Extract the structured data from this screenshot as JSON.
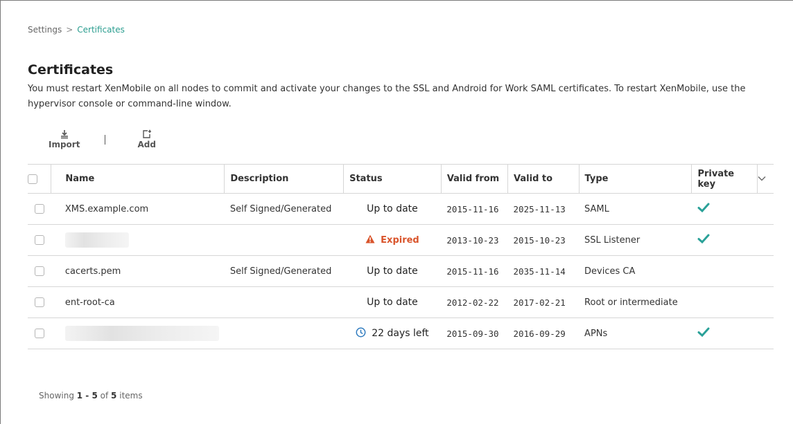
{
  "breadcrumb": {
    "root": "Settings",
    "separator": ">",
    "current": "Certificates"
  },
  "page": {
    "title": "Certificates",
    "intro": "You must restart XenMobile on all nodes to commit and activate your changes to the SSL and Android for Work SAML certificates. To restart XenMobile, use the hypervisor console or command-line window."
  },
  "toolbar": {
    "import_label": "Import",
    "add_label": "Add"
  },
  "table": {
    "headers": {
      "name": "Name",
      "description": "Description",
      "status": "Status",
      "valid_from": "Valid from",
      "valid_to": "Valid to",
      "type": "Type",
      "private_key": "Private key"
    },
    "rows": [
      {
        "name": "XMS.example.com",
        "description": "Self Signed/Generated",
        "status": "Up to date",
        "status_kind": "ok",
        "valid_from": "2015-11-16",
        "valid_to": "2025-11-13",
        "type": "SAML",
        "private_key": true
      },
      {
        "name": "",
        "name_redacted": true,
        "description": "",
        "status": "Expired",
        "status_kind": "expired",
        "valid_from": "2013-10-23",
        "valid_to": "2015-10-23",
        "type": "SSL Listener",
        "private_key": true
      },
      {
        "name": "cacerts.pem",
        "description": "Self Signed/Generated",
        "status": "Up to date",
        "status_kind": "ok",
        "valid_from": "2015-11-16",
        "valid_to": "2035-11-14",
        "type": "Devices CA",
        "private_key": false
      },
      {
        "name": "ent-root-ca",
        "description": "",
        "status": "Up to date",
        "status_kind": "ok",
        "valid_from": "2012-02-22",
        "valid_to": "2017-02-21",
        "type": "Root or intermediate",
        "private_key": false
      },
      {
        "name": "",
        "name_redacted": true,
        "description": "",
        "status": "22 days left",
        "status_kind": "expiring",
        "valid_from": "2015-09-30",
        "valid_to": "2016-09-29",
        "type": "APNs",
        "private_key": true
      }
    ]
  },
  "footer": {
    "prefix": "Showing",
    "range": "1 - 5",
    "middle": "of",
    "total": "5",
    "suffix": "items"
  },
  "colors": {
    "accent": "#2a9d8f",
    "check": "#2aa198",
    "expired": "#d9542b",
    "clock": "#2f7bbf"
  },
  "icons": {
    "import": "import-icon",
    "add": "add-icon",
    "check": "checkmark-icon",
    "warning": "warning-icon",
    "clock": "clock-icon",
    "menu": "chevron-down-icon"
  }
}
